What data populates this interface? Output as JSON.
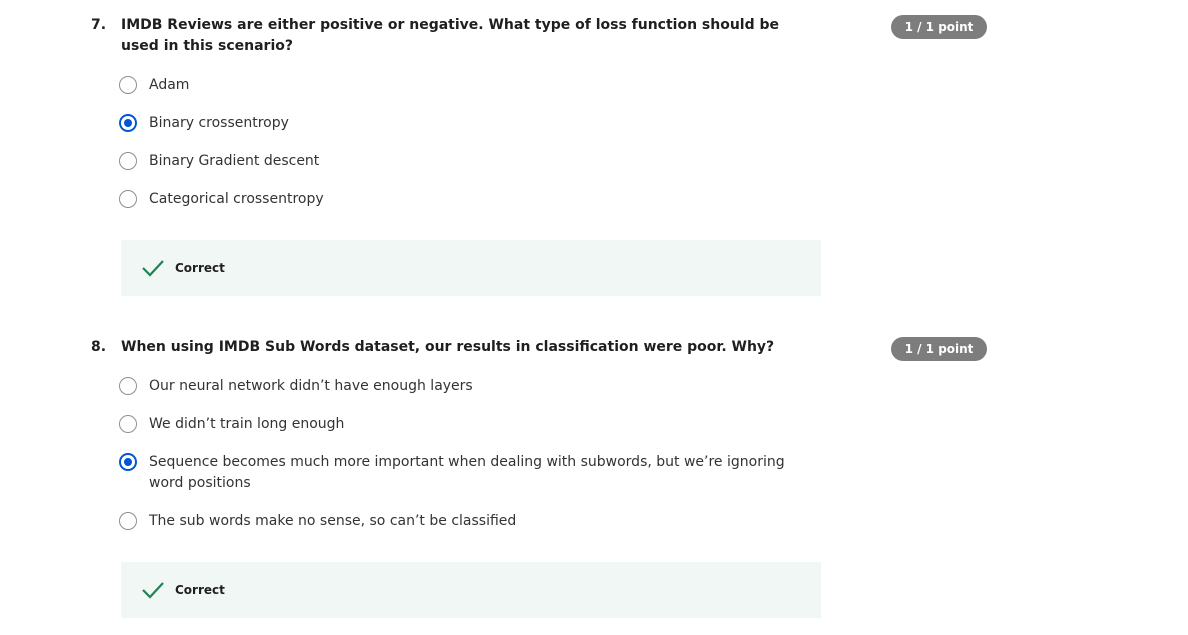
{
  "questions": [
    {
      "number": "7.",
      "prompt": "IMDB Reviews are either positive or negative. What type of loss function should be used in this scenario?",
      "points": "1 / 1 point",
      "options": [
        {
          "label": "Adam",
          "selected": false
        },
        {
          "label": "Binary crossentropy",
          "selected": true
        },
        {
          "label": "Binary Gradient descent",
          "selected": false
        },
        {
          "label": "Categorical crossentropy",
          "selected": false
        }
      ],
      "feedback": "Correct"
    },
    {
      "number": "8.",
      "prompt": "When using IMDB Sub Words dataset, our results in classification were poor. Why?",
      "points": "1 / 1 point",
      "options": [
        {
          "label": "Our neural network didn’t have enough layers",
          "selected": false
        },
        {
          "label": "We didn’t train long enough",
          "selected": false
        },
        {
          "label": "Sequence becomes much more important when dealing with subwords, but we’re ignoring word positions",
          "selected": true
        },
        {
          "label": "The sub words make no sense, so can’t be classified",
          "selected": false
        }
      ],
      "feedback": "Correct"
    }
  ],
  "colors": {
    "accent": "#0056d2",
    "success": "#1f8354",
    "badge": "#7d7d7d",
    "feedback_bg": "#f1f7f5"
  },
  "icons": {
    "selected_radio": "radio-selected-icon",
    "unselected_radio": "radio-unselected-icon",
    "feedback": "checkmark-icon"
  }
}
